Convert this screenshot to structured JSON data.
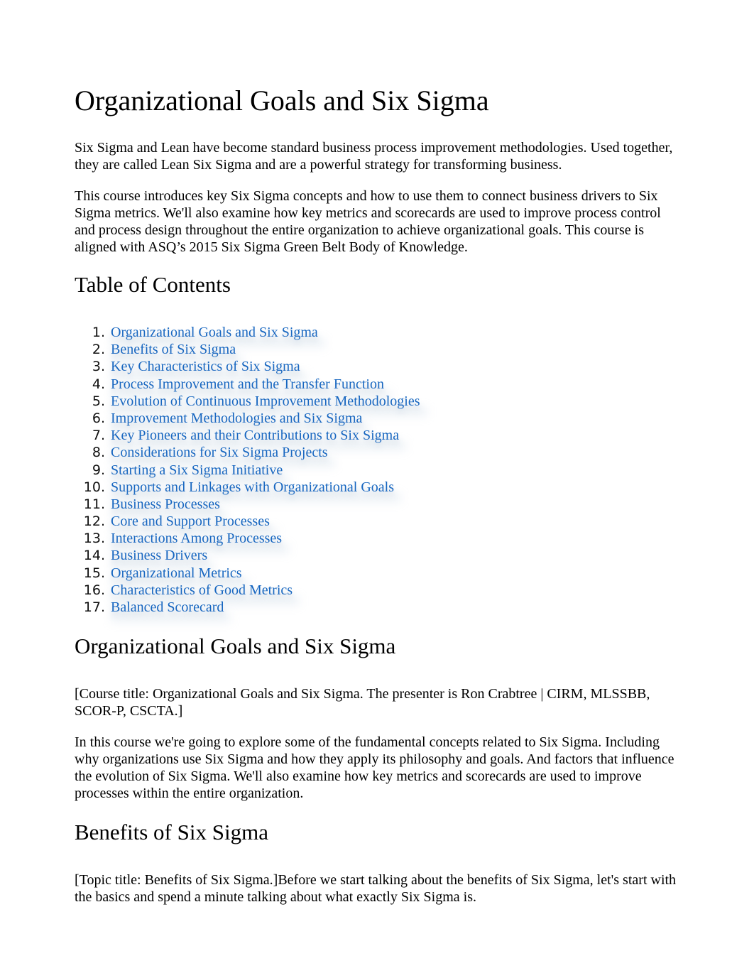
{
  "document": {
    "title": "Organizational Goals and Six Sigma",
    "intro_paragraphs": [
      "Six Sigma and Lean have become standard business process improvement methodologies. Used together, they are called Lean Six Sigma and are a powerful strategy for transforming business.",
      "This course introduces key Six Sigma concepts and how to use them to connect business drivers to Six Sigma metrics. We'll also examine how key metrics and scorecards are used to improve process control and process design throughout the entire organization to achieve organizational goals. This course is aligned with ASQ’s 2015 Six Sigma Green Belt Body of Knowledge."
    ],
    "toc": {
      "heading": "Table of Contents",
      "link_color": "#1565c0",
      "items": [
        {
          "number": "1.",
          "label": "Organizational Goals and Six Sigma"
        },
        {
          "number": "2.",
          "label": "Benefits of Six Sigma"
        },
        {
          "number": "3.",
          "label": "Key Characteristics of Six Sigma"
        },
        {
          "number": "4.",
          "label": "Process Improvement and the Transfer Function"
        },
        {
          "number": "5.",
          "label": "Evolution of Continuous Improvement Methodologies"
        },
        {
          "number": "6.",
          "label": "Improvement Methodologies and Six Sigma"
        },
        {
          "number": "7.",
          "label": "Key Pioneers and their Contributions to Six Sigma"
        },
        {
          "number": "8.",
          "label": "Considerations for Six Sigma Projects"
        },
        {
          "number": "9.",
          "label": "Starting a Six Sigma Initiative"
        },
        {
          "number": "10.",
          "label": "Supports and Linkages with Organizational Goals"
        },
        {
          "number": "11.",
          "label": "Business Processes"
        },
        {
          "number": "12.",
          "label": "Core and Support Processes"
        },
        {
          "number": "13.",
          "label": "Interactions Among Processes"
        },
        {
          "number": "14.",
          "label": "Business Drivers"
        },
        {
          "number": "15.",
          "label": "Organizational Metrics"
        },
        {
          "number": "16.",
          "label": "Characteristics of Good Metrics"
        },
        {
          "number": "17.",
          "label": "Balanced Scorecard"
        }
      ]
    },
    "sections": [
      {
        "heading": "Organizational Goals and Six Sigma",
        "paragraphs": [
          "[Course title: Organizational Goals and Six Sigma. The presenter is Ron Crabtree | CIRM, MLSSBB, SCOR-P, CSCTA.]",
          "In this course we're going to explore some of the fundamental concepts related to Six Sigma. Including why organizations use Six Sigma and how they apply its philosophy and goals. And factors that influence the evolution of Six Sigma. We'll also examine how key metrics and scorecards are used to improve processes within the entire organization."
        ]
      },
      {
        "heading": "Benefits of Six Sigma",
        "paragraphs": [
          "[Topic title: Benefits of Six Sigma.]Before we start talking about the benefits of Six Sigma, let's start with the basics and spend a minute talking about what exactly Six Sigma is."
        ]
      }
    ]
  }
}
